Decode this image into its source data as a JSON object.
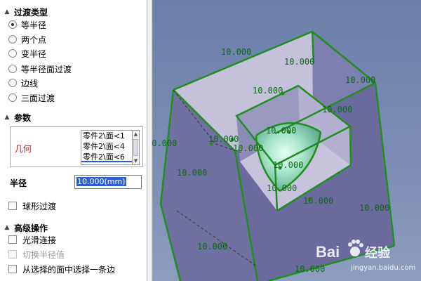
{
  "panel": {
    "fillet_type": {
      "title": "过渡类型",
      "options": [
        {
          "label": "等半径",
          "selected": true
        },
        {
          "label": "两个点",
          "selected": false
        },
        {
          "label": "变半径",
          "selected": false
        },
        {
          "label": "等半径面过渡",
          "selected": false
        },
        {
          "label": "边线",
          "selected": false
        },
        {
          "label": "三面过渡",
          "selected": false
        }
      ]
    },
    "params": {
      "title": "参数",
      "geometry_label": "几何",
      "faces": [
        "零件2\\面<1",
        "零件2\\面<4",
        "零件2\\面<6"
      ],
      "radius_label": "半径",
      "radius_value": "10.000(mm)",
      "sphere_fillet_label": "球形过渡"
    },
    "advanced": {
      "title": "高级操作",
      "options": [
        {
          "label": "光滑连接",
          "enabled": true
        },
        {
          "label": "切换半径值",
          "enabled": false
        },
        {
          "label": "从选择的面中选择一条边",
          "enabled": true
        }
      ]
    }
  },
  "viewport": {
    "dimension_text": "10.000",
    "colors": {
      "edge": "#1f8f1f",
      "face_light": "#c9c4dd",
      "face_dark": "#6e73a3",
      "background": "#7b8db4"
    }
  },
  "watermark": {
    "brand": "Bai",
    "brand_suffix": "经验",
    "url": "jingyan.baidu.com"
  }
}
